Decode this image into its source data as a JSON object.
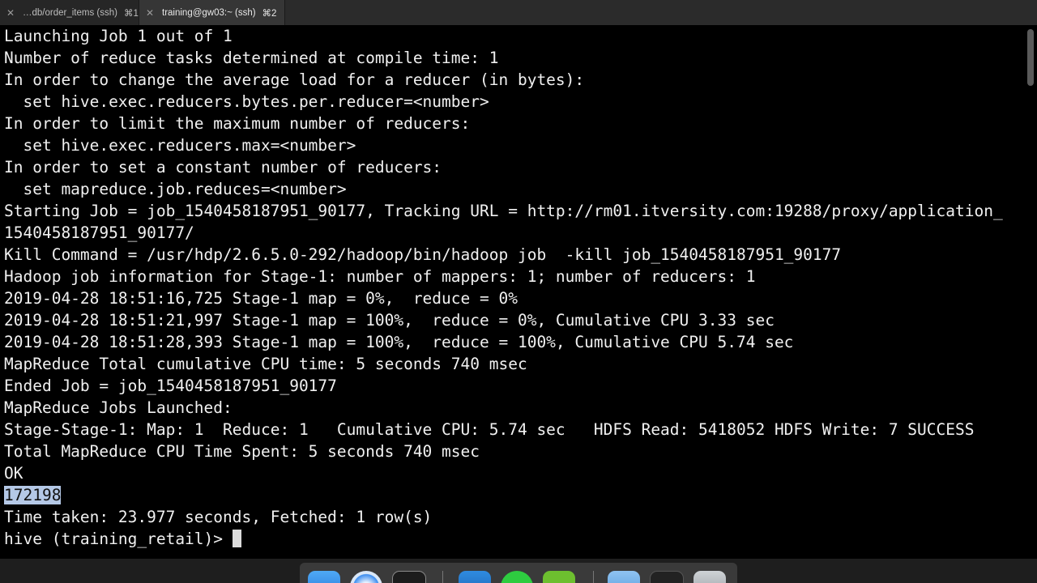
{
  "tabs": [
    {
      "title": "…db/order_items (ssh)",
      "shortcut": "⌘1",
      "active": false
    },
    {
      "title": "training@gw03:~ (ssh)",
      "shortcut": "⌘2",
      "active": true
    }
  ],
  "terminal": {
    "lines": [
      "Launching Job 1 out of 1",
      "Number of reduce tasks determined at compile time: 1",
      "In order to change the average load for a reducer (in bytes):",
      "  set hive.exec.reducers.bytes.per.reducer=<number>",
      "In order to limit the maximum number of reducers:",
      "  set hive.exec.reducers.max=<number>",
      "In order to set a constant number of reducers:",
      "  set mapreduce.job.reduces=<number>",
      "Starting Job = job_1540458187951_90177, Tracking URL = http://rm01.itversity.com:19288/proxy/application_",
      "1540458187951_90177/",
      "Kill Command = /usr/hdp/2.6.5.0-292/hadoop/bin/hadoop job  -kill job_1540458187951_90177",
      "Hadoop job information for Stage-1: number of mappers: 1; number of reducers: 1",
      "2019-04-28 18:51:16,725 Stage-1 map = 0%,  reduce = 0%",
      "2019-04-28 18:51:21,997 Stage-1 map = 100%,  reduce = 0%, Cumulative CPU 3.33 sec",
      "2019-04-28 18:51:28,393 Stage-1 map = 100%,  reduce = 100%, Cumulative CPU 5.74 sec",
      "MapReduce Total cumulative CPU time: 5 seconds 740 msec",
      "Ended Job = job_1540458187951_90177",
      "MapReduce Jobs Launched:",
      "Stage-Stage-1: Map: 1  Reduce: 1   Cumulative CPU: 5.74 sec   HDFS Read: 5418052 HDFS Write: 7 SUCCESS",
      "Total MapReduce CPU Time Spent: 5 seconds 740 msec",
      "OK"
    ],
    "result_value": "172198",
    "time_taken": "Time taken: 23.977 seconds, Fetched: 1 row(s)",
    "prompt": "hive (training_retail)> "
  },
  "colors": {
    "terminal_bg": "#000000",
    "terminal_fg": "#f0f0f0",
    "selection_bg": "#b4c8e6",
    "tabbar_bg": "#2b2b2b"
  },
  "dock": {
    "icons": [
      "finder-icon",
      "safari-icon",
      "terminal-icon",
      "vscode-icon",
      "whatsapp-icon",
      "sublime-icon",
      "downloads-folder-icon",
      "media-icon",
      "trash-icon"
    ]
  }
}
